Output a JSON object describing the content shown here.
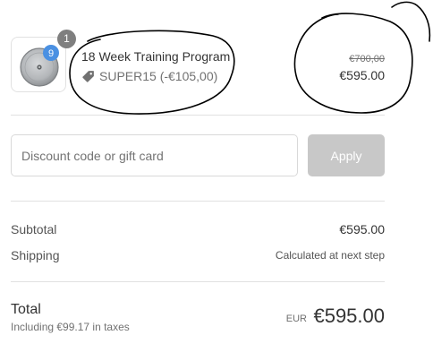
{
  "line_item": {
    "quantity": "1",
    "product_title": "18 Week Training Program",
    "discount_code_label": "SUPER15 (-€105,00)",
    "original_price": "€700,00",
    "price": "€595.00",
    "thumbnail_badge": "9"
  },
  "discount_form": {
    "placeholder": "Discount code or gift card",
    "apply_label": "Apply"
  },
  "summary": {
    "subtotal_label": "Subtotal",
    "subtotal_value": "€595.00",
    "shipping_label": "Shipping",
    "shipping_value": "Calculated at next step",
    "total_label": "Total",
    "tax_note": "Including €99.17 in taxes",
    "currency": "EUR",
    "total_value": "€595.00"
  },
  "colors": {
    "badge_blue": "#4a90e2",
    "quantity_badge": "#7f7f7f",
    "apply_disabled": "#c8c8c8",
    "annotation_ink": "#000000"
  },
  "icons": {
    "discount_tag": "tag-icon",
    "product_image": "product-thumbnail"
  }
}
